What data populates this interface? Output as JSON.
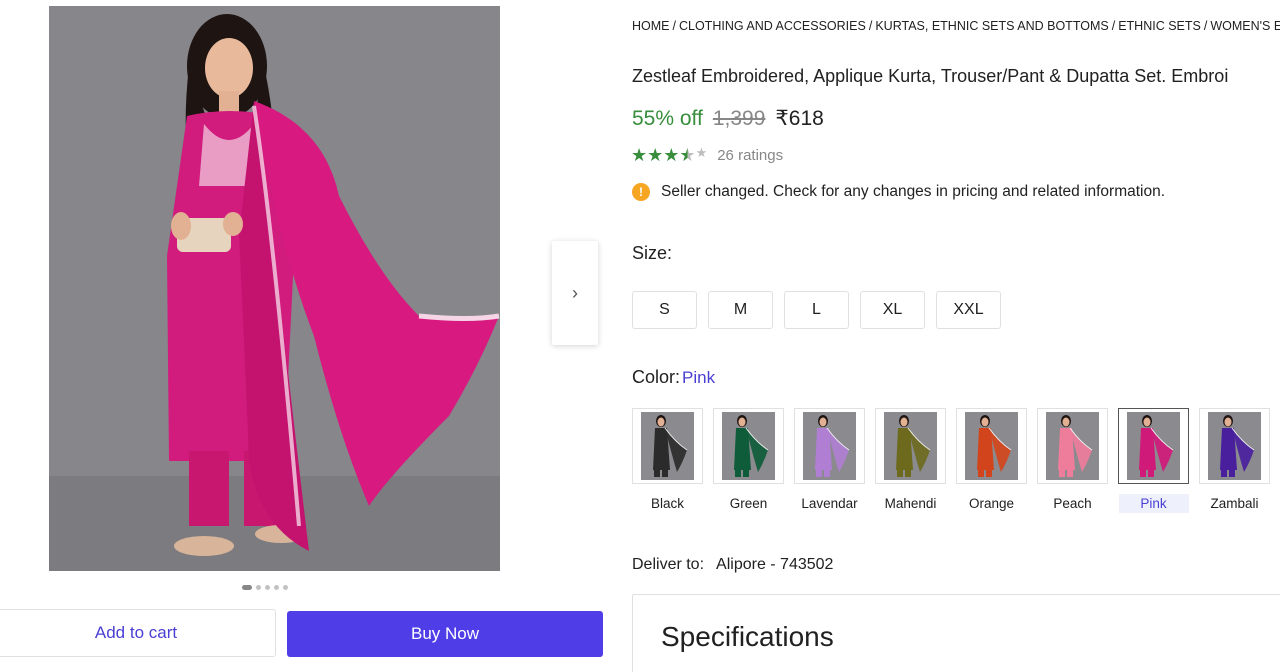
{
  "breadcrumbs": [
    "HOME",
    "CLOTHING AND ACCESSORIES",
    "KURTAS, ETHNIC SETS AND BOTTOMS",
    "ETHNIC SETS",
    "WOMEN'S ETHNIC"
  ],
  "product": {
    "title": "Zestleaf Embroidered, Applique Kurta, Trouser/Pant & Dupatta Set. Embroi",
    "discount": "55% off",
    "mrp": "1,399",
    "price": "₹618",
    "rating_value": 3.5,
    "ratings_text": "26 ratings",
    "notice": "Seller changed. Check for any changes in pricing and related information."
  },
  "size": {
    "label": "Size:",
    "options": [
      "S",
      "M",
      "L",
      "XL",
      "XXL"
    ]
  },
  "color": {
    "label": "Color:",
    "selected": "Pink",
    "options": [
      {
        "name": "Black",
        "hex": "#2b2b2b"
      },
      {
        "name": "Green",
        "hex": "#0f5c3a"
      },
      {
        "name": "Lavendar",
        "hex": "#b07fd4"
      },
      {
        "name": "Mahendi",
        "hex": "#6d6a1e"
      },
      {
        "name": "Orange",
        "hex": "#d2451c"
      },
      {
        "name": "Peach",
        "hex": "#ee7d9c"
      },
      {
        "name": "Pink",
        "hex": "#d01a7a"
      },
      {
        "name": "Zambali",
        "hex": "#4a1f9e"
      }
    ]
  },
  "delivery": {
    "label": "Deliver to:",
    "location": "Alipore - 743502"
  },
  "actions": {
    "add_to_cart": "Add to cart",
    "buy_now": "Buy Now"
  },
  "gallery": {
    "dot_count": 5,
    "active_dot": 0,
    "dress_color": "#d11c7e"
  },
  "specifications_title": "Specifications",
  "theme": {
    "accent": "#4f3de8",
    "discount_green": "#388e3c"
  }
}
